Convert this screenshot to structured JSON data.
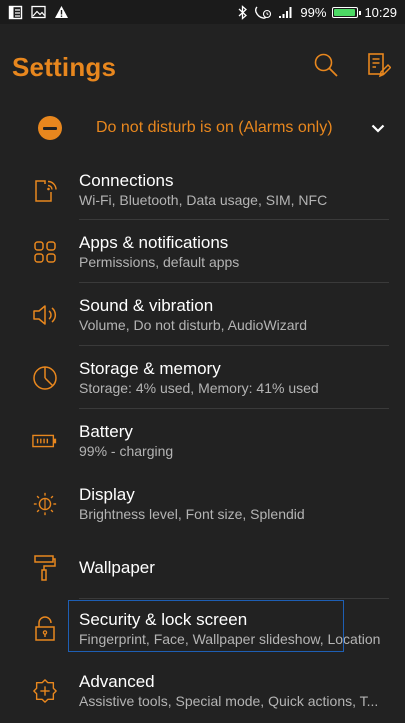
{
  "status_bar": {
    "battery_percent": "99%",
    "battery_level": 0.99,
    "time": "10:29"
  },
  "header": {
    "title": "Settings"
  },
  "dnd_banner": {
    "text": "Do not disturb is on (Alarms only)"
  },
  "settings": [
    {
      "label": "Connections",
      "subtitle": "Wi-Fi, Bluetooth, Data usage, SIM, NFC"
    },
    {
      "label": "Apps & notifications",
      "subtitle": "Permissions, default apps"
    },
    {
      "label": "Sound & vibration",
      "subtitle": "Volume, Do not disturb, AudioWizard"
    },
    {
      "label": "Storage & memory",
      "subtitle": "Storage: 4% used, Memory: 41% used"
    },
    {
      "label": "Battery",
      "subtitle": "99% - charging"
    },
    {
      "label": "Display",
      "subtitle": "Brightness level, Font size, Splendid"
    },
    {
      "label": "Wallpaper",
      "subtitle": ""
    },
    {
      "label": "Security & lock screen",
      "subtitle": "Fingerprint, Face, Wallpaper slideshow, Location"
    },
    {
      "label": "Advanced",
      "subtitle": "Assistive tools, Special mode, Quick actions, T..."
    }
  ],
  "colors": {
    "accent": "#e8871e",
    "background": "#222222",
    "focus_outline": "#1e5fb4",
    "battery_fill": "#4cd964"
  },
  "icons": {
    "status_left": [
      "notes-icon",
      "image-icon",
      "warning-icon"
    ],
    "status_right": [
      "bluetooth-icon",
      "call-icon",
      "signal-icon",
      "battery-icon"
    ],
    "header": [
      "search-icon",
      "edit-icon"
    ],
    "settings": [
      "phone-wifi-icon",
      "apps-grid-icon",
      "speaker-icon",
      "pie-chart-icon",
      "battery-icon",
      "brightness-icon",
      "paint-roller-icon",
      "lock-icon",
      "advanced-icon"
    ]
  }
}
